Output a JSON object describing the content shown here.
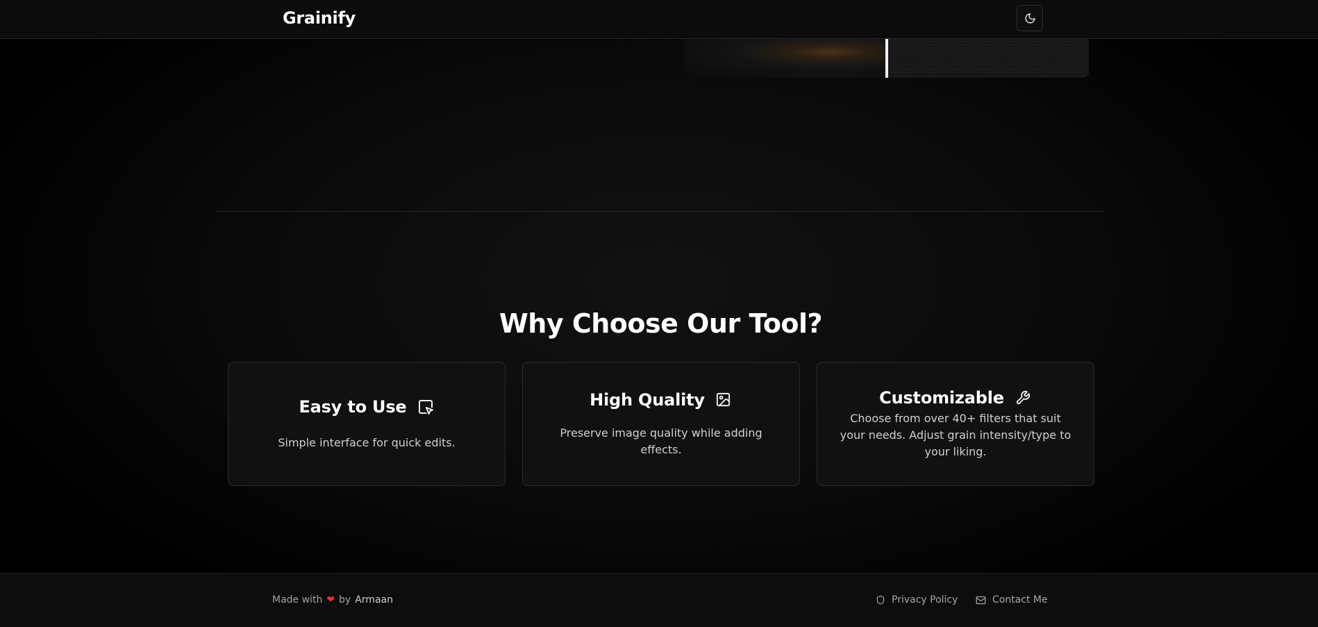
{
  "header": {
    "brand": "Grainify",
    "theme_toggle_icon": "moon-icon"
  },
  "comparison": {
    "left_label": "original-image-preview",
    "right_label": "grain-image-preview"
  },
  "features": {
    "title": "Why Choose Our Tool?",
    "cards": [
      {
        "title": "Easy to Use",
        "icon": "pointer-cursor-icon",
        "description": "Simple interface for quick edits."
      },
      {
        "title": "High Quality",
        "icon": "image-icon",
        "description": "Preserve image quality while adding effects."
      },
      {
        "title": "Customizable",
        "icon": "wrench-icon",
        "description": "Choose from over 40+ filters that suit your needs. Adjust grain intensity/type to your liking."
      }
    ]
  },
  "footer": {
    "made_with": "Made with",
    "heart": "❤",
    "by": "by",
    "author": "Armaan",
    "privacy_label": "Privacy Policy",
    "contact_label": "Contact Me"
  },
  "colors": {
    "background": "#000000",
    "accent_heart": "#e0333a",
    "card_border": "#2a2a2a"
  }
}
